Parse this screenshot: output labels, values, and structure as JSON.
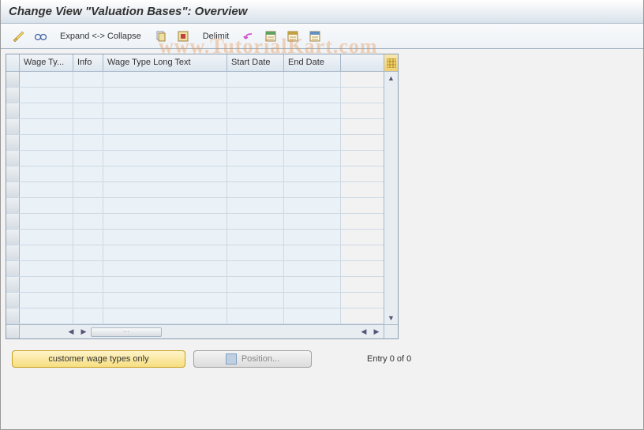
{
  "title": "Change View \"Valuation Bases\": Overview",
  "toolbar": {
    "expand_collapse": "Expand <-> Collapse",
    "delimit": "Delimit"
  },
  "grid": {
    "columns": {
      "wage_type": "Wage Ty...",
      "info": "Info",
      "long_text": "Wage Type Long Text",
      "start_date": "Start Date",
      "end_date": "End Date"
    },
    "rows": [
      {
        "wage_type": "",
        "info": "",
        "long_text": "",
        "start_date": "",
        "end_date": ""
      },
      {
        "wage_type": "",
        "info": "",
        "long_text": "",
        "start_date": "",
        "end_date": ""
      },
      {
        "wage_type": "",
        "info": "",
        "long_text": "",
        "start_date": "",
        "end_date": ""
      },
      {
        "wage_type": "",
        "info": "",
        "long_text": "",
        "start_date": "",
        "end_date": ""
      },
      {
        "wage_type": "",
        "info": "",
        "long_text": "",
        "start_date": "",
        "end_date": ""
      },
      {
        "wage_type": "",
        "info": "",
        "long_text": "",
        "start_date": "",
        "end_date": ""
      },
      {
        "wage_type": "",
        "info": "",
        "long_text": "",
        "start_date": "",
        "end_date": ""
      },
      {
        "wage_type": "",
        "info": "",
        "long_text": "",
        "start_date": "",
        "end_date": ""
      },
      {
        "wage_type": "",
        "info": "",
        "long_text": "",
        "start_date": "",
        "end_date": ""
      },
      {
        "wage_type": "",
        "info": "",
        "long_text": "",
        "start_date": "",
        "end_date": ""
      },
      {
        "wage_type": "",
        "info": "",
        "long_text": "",
        "start_date": "",
        "end_date": ""
      },
      {
        "wage_type": "",
        "info": "",
        "long_text": "",
        "start_date": "",
        "end_date": ""
      },
      {
        "wage_type": "",
        "info": "",
        "long_text": "",
        "start_date": "",
        "end_date": ""
      },
      {
        "wage_type": "",
        "info": "",
        "long_text": "",
        "start_date": "",
        "end_date": ""
      },
      {
        "wage_type": "",
        "info": "",
        "long_text": "",
        "start_date": "",
        "end_date": ""
      },
      {
        "wage_type": "",
        "info": "",
        "long_text": "",
        "start_date": "",
        "end_date": ""
      }
    ]
  },
  "footer": {
    "customer_wage_types": "customer wage types only",
    "position": "Position...",
    "entry_status": "Entry 0 of 0"
  },
  "watermark": "www.TutorialKart.com",
  "icons": {
    "pencils": "pencils-icon",
    "glasses": "glasses-icon",
    "copy": "copy-icon",
    "select_all": "select-all-icon",
    "delimit": "delimit-icon",
    "undo": "undo-icon",
    "sheet1": "sheet1-icon",
    "sheet2": "sheet2-icon",
    "sheet3": "sheet3-icon",
    "config": "table-settings-icon"
  }
}
